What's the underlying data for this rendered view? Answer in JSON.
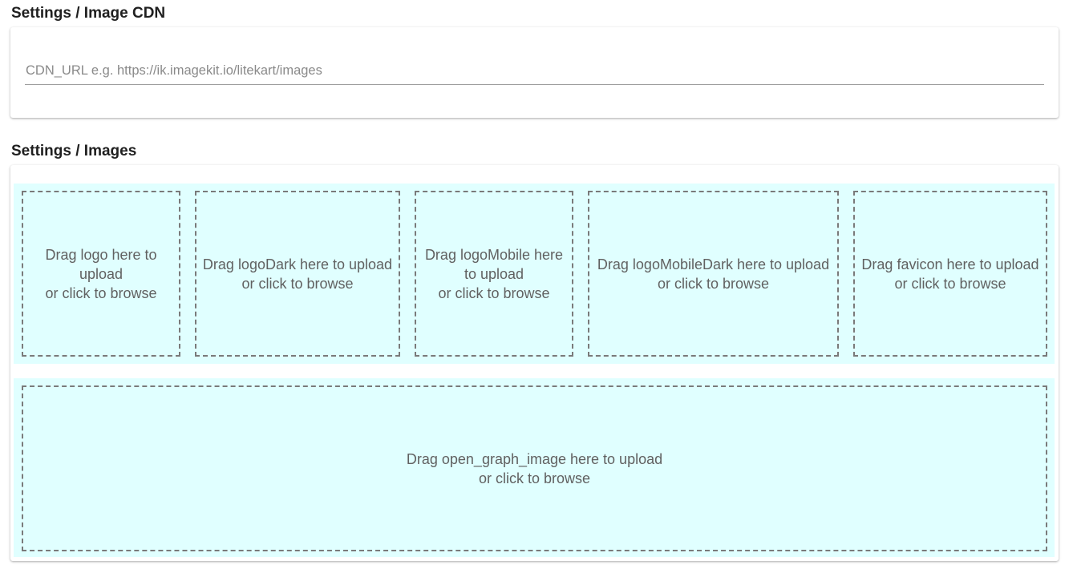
{
  "cdn_section": {
    "title": "Settings / Image CDN",
    "input_value": "",
    "input_placeholder": "CDN_URL e.g. https://ik.imagekit.io/litekart/images"
  },
  "images_section": {
    "title": "Settings / Images",
    "dropzones": [
      {
        "field": "logo",
        "text": "Drag logo here to\nupload\nor click to browse"
      },
      {
        "field": "logoDark",
        "text": "Drag logoDark here to upload\nor click to browse"
      },
      {
        "field": "logoMobile",
        "text": "Drag logoMobile here\nto upload\nor click to browse"
      },
      {
        "field": "logoMobileDark",
        "text": "Drag logoMobileDark here to upload\nor click to browse"
      },
      {
        "field": "favicon",
        "text": "Drag favicon here to upload\nor click to browse"
      }
    ],
    "og_dropzone": {
      "field": "open_graph_image",
      "text": "Drag open_graph_image here to upload\nor click to browse"
    }
  },
  "colors": {
    "dropzone_bg": "#e0ffff",
    "dropzone_border": "#7a7a7a",
    "dropzone_text": "#616161"
  }
}
